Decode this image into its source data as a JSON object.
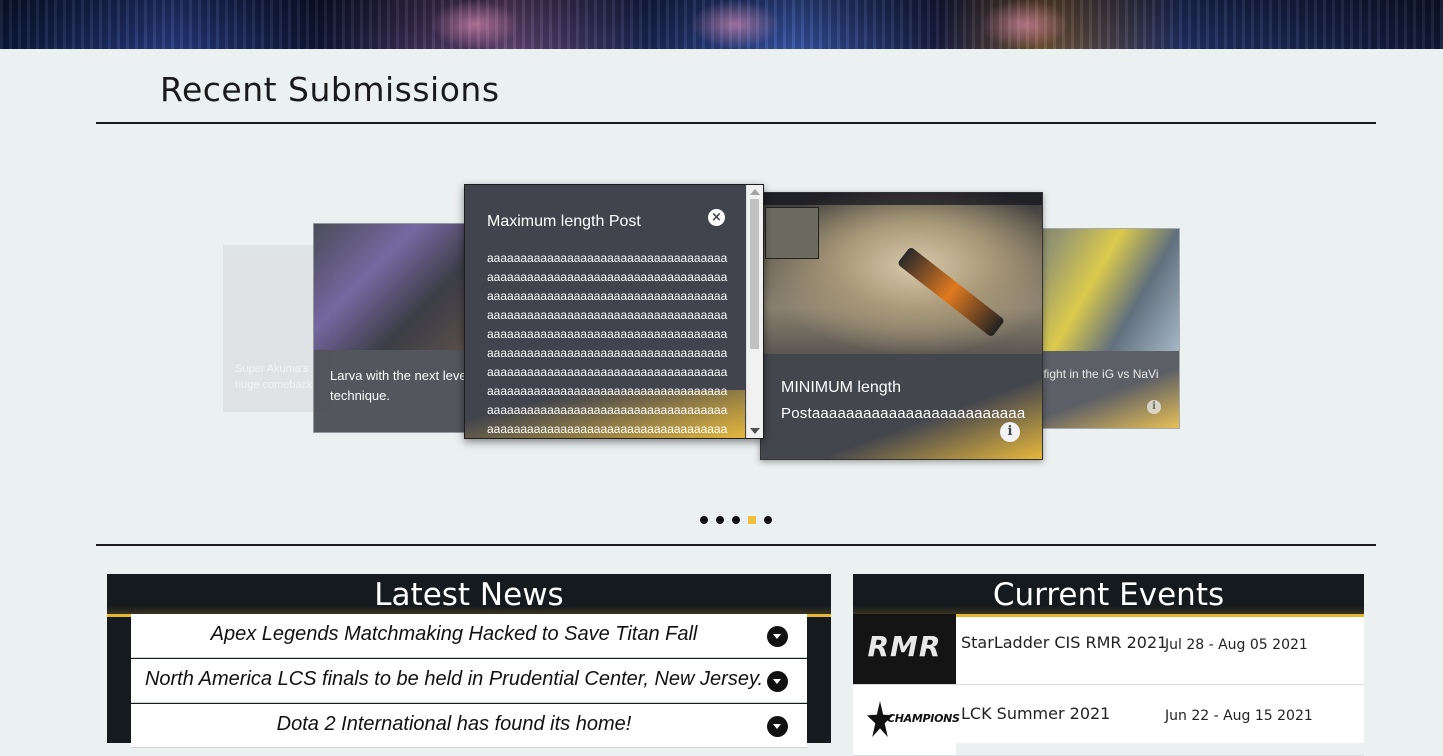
{
  "banner": {
    "icon": "arena-crowd-image"
  },
  "recent": {
    "title": "Recent Submissions",
    "cards": {
      "far_left": {
        "caption": "Super Akuma's huge comeback"
      },
      "left": {
        "caption": "Larva with the next level technique."
      },
      "center": {
        "title": "Maximum length Post",
        "close_icon": "×",
        "body": "aaaaaaaaaaaaaaaaaaaaaaaaaaaaaaaaaaaaaaaaaaaaaaaaaaaaaaaaaaaaaaaaaaaaaaaaaaaaaaaaaaaaaaaaaaaaaaaaaaaaaaaaaaaaaaaaaaaaaaaaaaaaaaaaaaaaaaaaaaaaaaaaaaaaaaaaaaaaaaaaaaaaaaaaaaaaaaaaaaaaaaaaaaaaaaaaaaaaaaaaaaaaaaaaaaaaaaaaaaaaaaaaaaaaaaaaaaaaaaaaaaaaaaaaaaaaaaaaaaaaaaaaaaaaaaaaaaaaaaaaaaaaaaaaaaaaaaaaaaaaaaaaaaaaaaaaaaaaaaaaaaaaaaaaaaaaaaaaaaaaaaaaaaaaaaaaaaaaaaaaaaaaaaaaaaaaaaaaaaaaaaaaaaaaaaaaaaaaaaaaaaaaaaaaaaaaaaaa"
      },
      "right": {
        "caption_line1": "MINIMUM length",
        "caption_line2": "Postaaaaaaaaaaaaaaaaaaaaaaaaa"
      },
      "right_far": {
        "caption": "Crazy teamfight in the iG vs NaVi Semifinals"
      }
    },
    "info_icon": "i",
    "pagination": {
      "count": 5,
      "active_index": 3,
      "active_color": "#f0c13a"
    }
  },
  "news": {
    "title": "Latest News",
    "items": [
      {
        "headline": "Apex Legends Matchmaking Hacked to Save Titan Fall"
      },
      {
        "headline": "North America LCS finals to be held in Prudential Center, New Jersey."
      },
      {
        "headline": "Dota 2 International has found its home!"
      }
    ]
  },
  "events": {
    "title": "Current Events",
    "items": [
      {
        "logo_text": "RMR",
        "name": "StarLadder CIS RMR 2021",
        "dates": "Jul 28 - Aug 05 2021"
      },
      {
        "logo_text": "CHAMPIONS",
        "name": "LCK Summer 2021",
        "dates": "Jun 22 - Aug 15 2021"
      }
    ]
  },
  "colors": {
    "accent": "#e6b732",
    "panel_bg": "#151a1f",
    "page_bg": "#ebf0f0"
  }
}
